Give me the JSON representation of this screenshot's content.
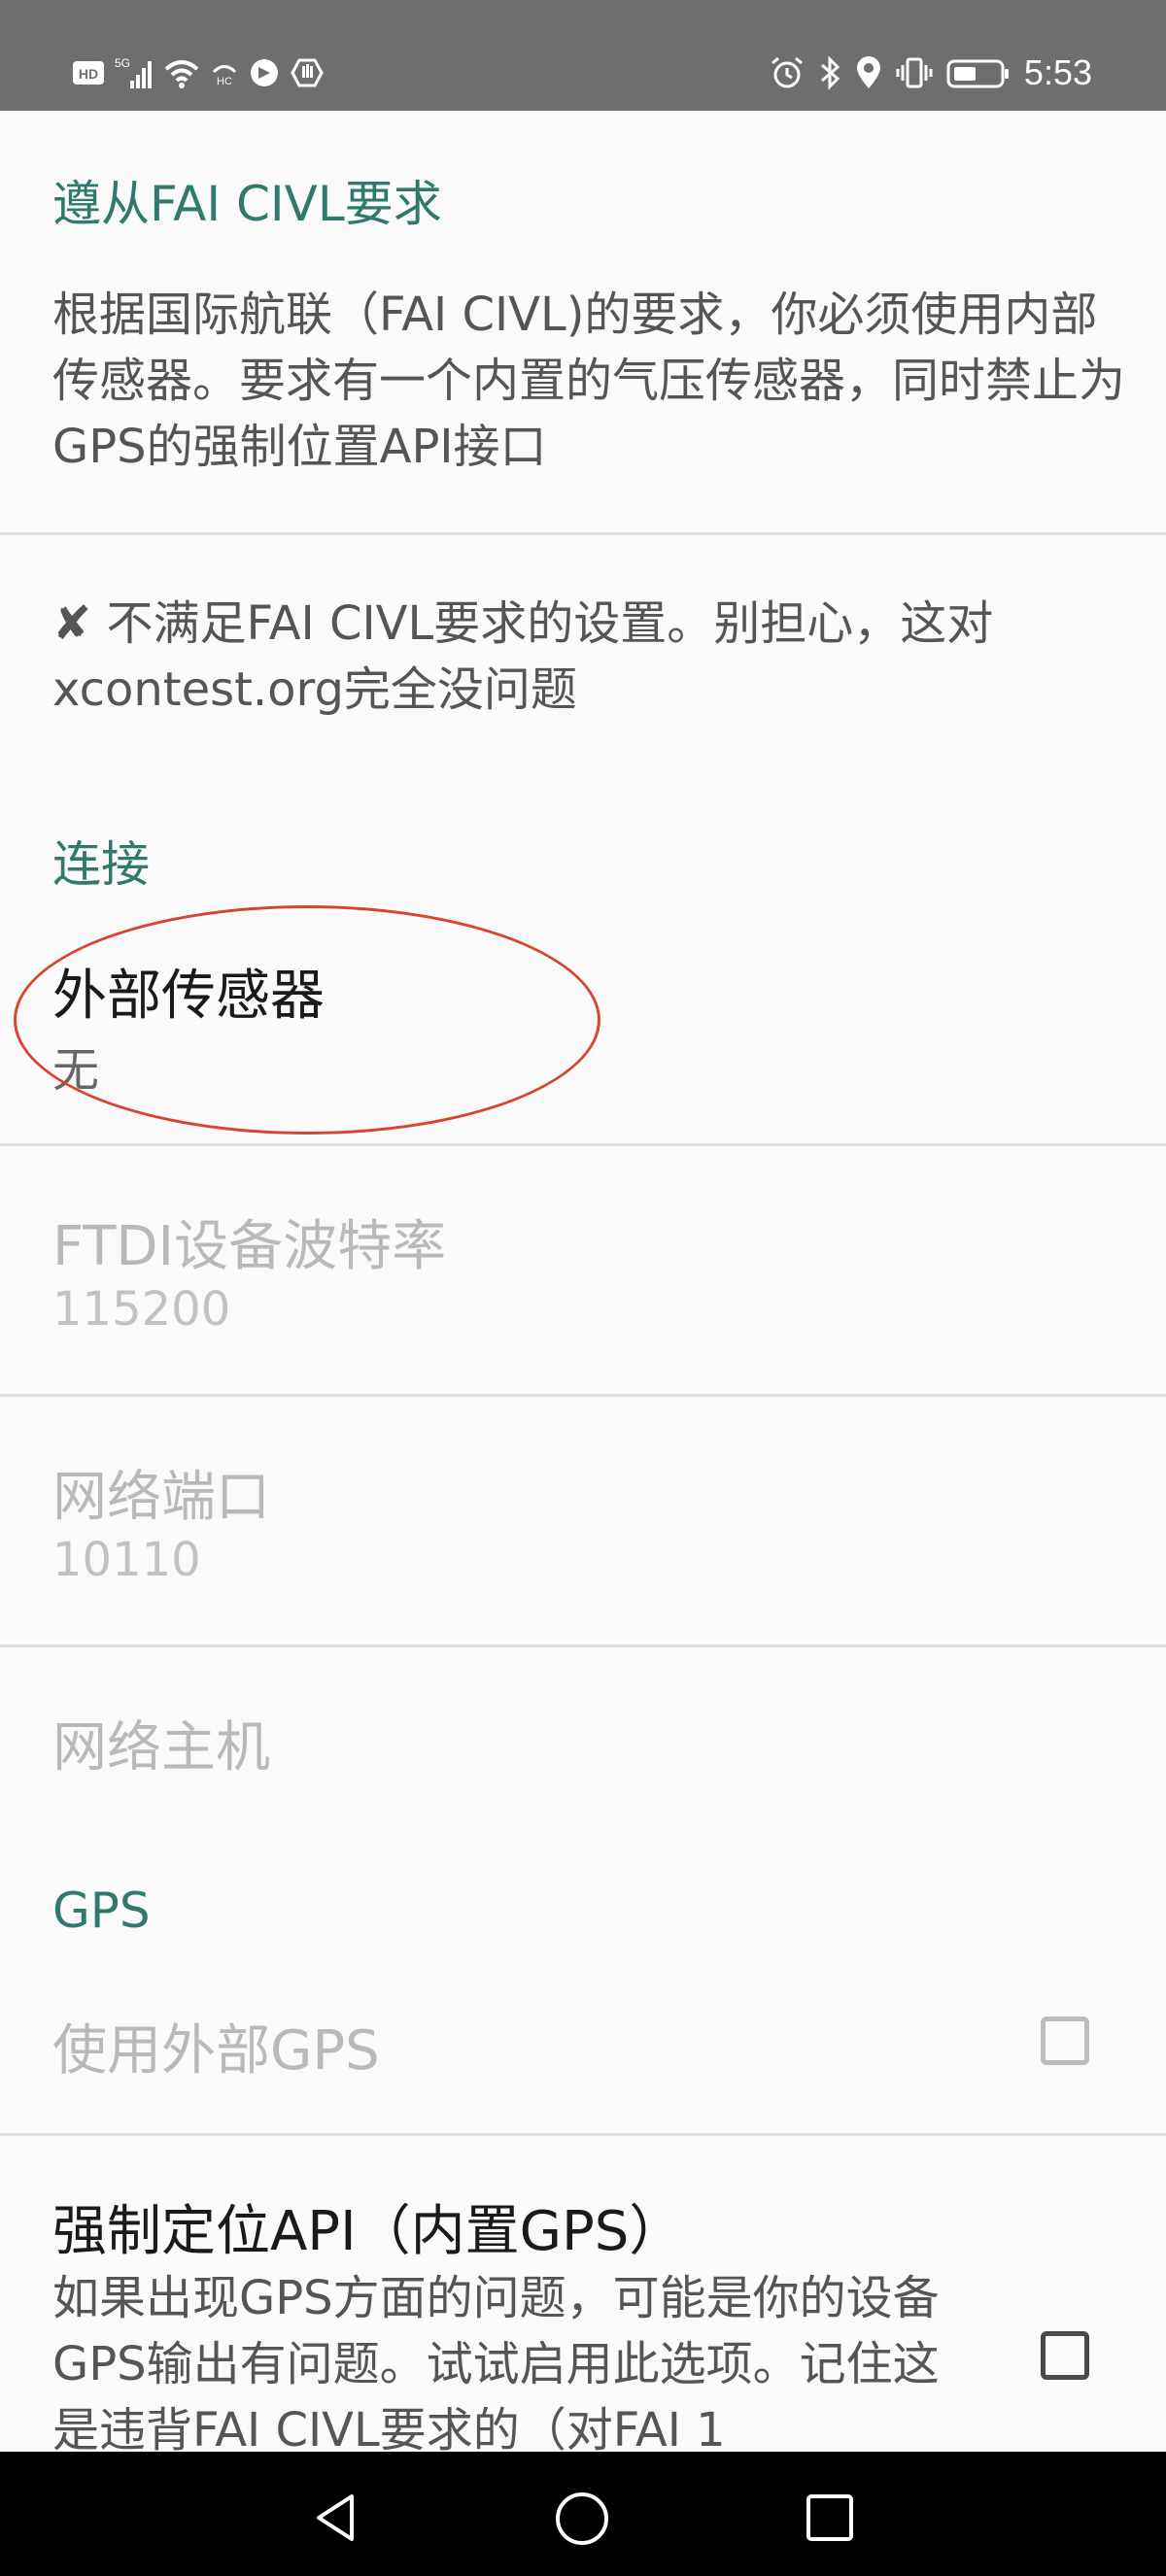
{
  "statusbar": {
    "time": "5:53",
    "icons_left": [
      "hd-icon",
      "signal-5g-icon",
      "wifi-icon",
      "hc-icon",
      "app-icon",
      "hand-icon"
    ],
    "icons_right": [
      "alarm-icon",
      "bluetooth-icon",
      "location-icon",
      "vibrate-icon",
      "battery-icon"
    ]
  },
  "sections": {
    "fai": {
      "header": "遵从FAI CIVL要求",
      "description": "根据国际航联（FAI CIVL)的要求，你必须使用内部传感器。要求有一个内置的气压传感器，同时禁止为GPS的强制位置API接口",
      "status_icon": "✘",
      "status_text": "不满足FAI CIVL要求的设置。别担心，这对xcontest.org完全没问题"
    },
    "connection": {
      "header": "连接",
      "external_sensor": {
        "title": "外部传感器",
        "summary": "无"
      },
      "ftdi_baud": {
        "title": "FTDI设备波特率",
        "summary": "115200"
      },
      "network_port": {
        "title": "网络端口",
        "summary": "10110"
      },
      "network_host": {
        "title": "网络主机"
      }
    },
    "gps": {
      "header": "GPS",
      "use_external_gps": {
        "title": "使用外部GPS",
        "checked": false,
        "enabled": false
      },
      "force_location_api": {
        "title": "强制定位API（内置GPS）",
        "summary": "如果出现GPS方面的问题，可能是你的设备GPS输出有问题。试试启用此选项。记住这是违背FAI CIVL要求的（对FAI 1",
        "checked": false,
        "enabled": true
      }
    }
  },
  "colors": {
    "accent": "#2f7a6d",
    "highlight": "#d8452f",
    "statusbar": "#6e6e6e",
    "navbar": "#000000"
  },
  "navbar": {
    "buttons": [
      "back-icon",
      "home-icon",
      "recents-icon"
    ]
  }
}
